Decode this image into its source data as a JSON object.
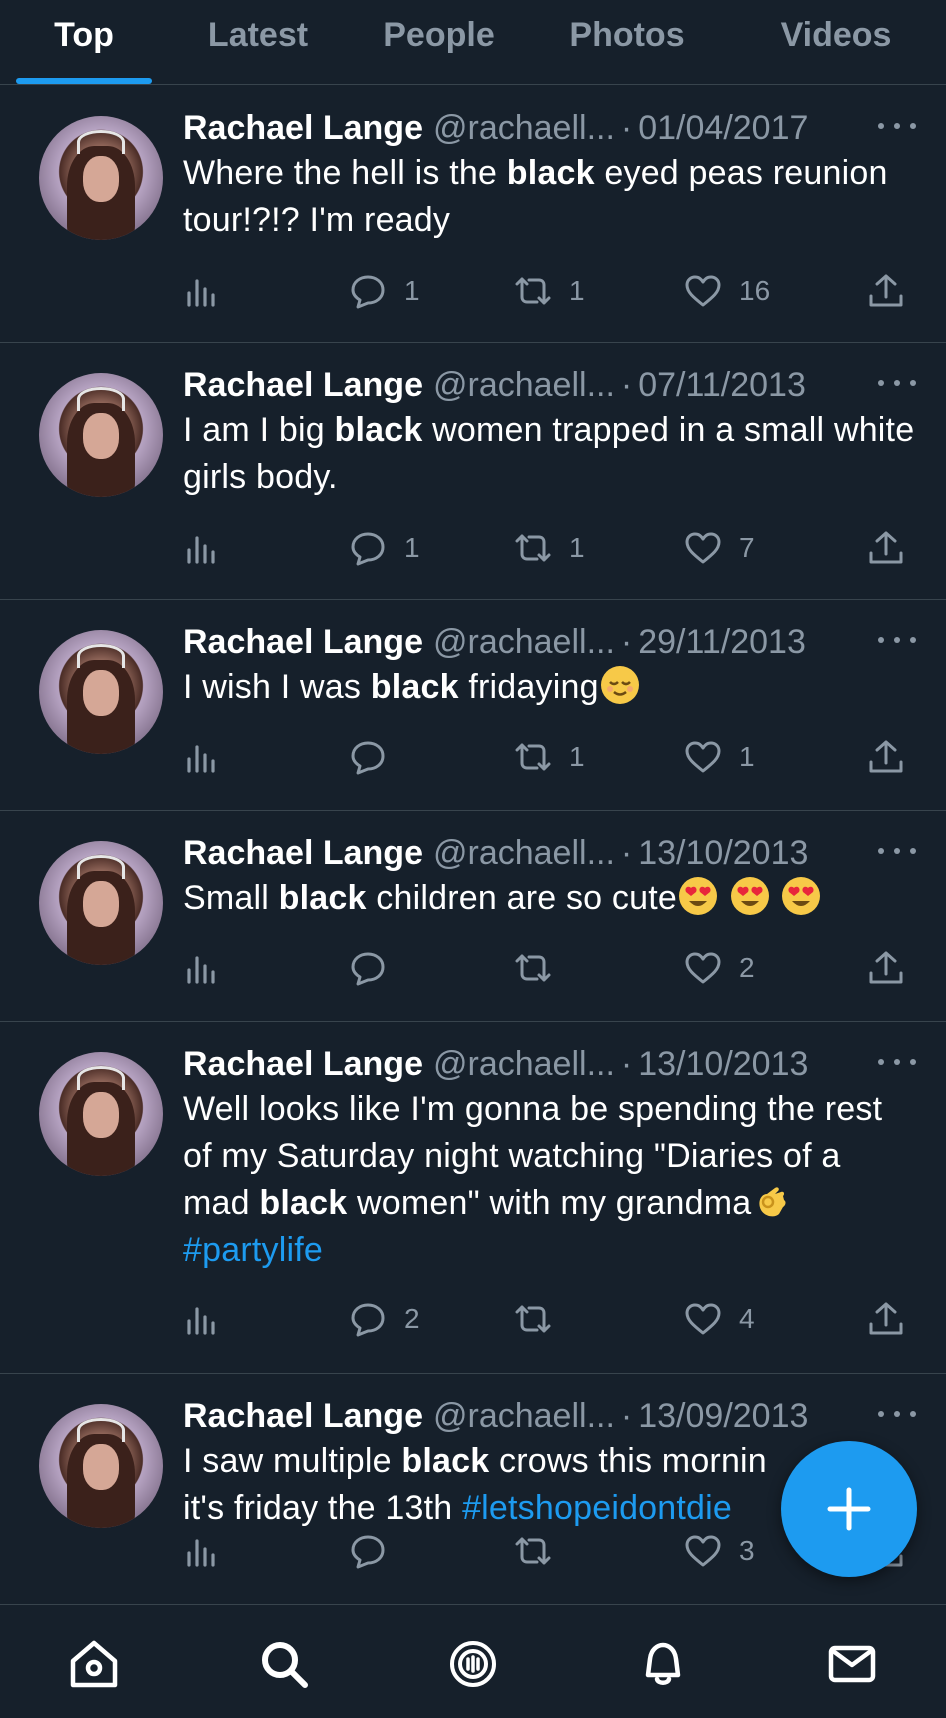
{
  "tabs": [
    {
      "label": "Top",
      "active": true
    },
    {
      "label": "Latest",
      "active": false
    },
    {
      "label": "People",
      "active": false
    },
    {
      "label": "Photos",
      "active": false
    },
    {
      "label": "Videos",
      "active": false
    }
  ],
  "tweets": [
    {
      "name": "Rachael Lange",
      "handle": "@rachaell...",
      "date": "01/04/2017",
      "text_parts": [
        "Where the hell is the ",
        "black",
        " eyed peas reunion tour!?!? I'm ready"
      ],
      "replies": "1",
      "retweets": "1",
      "likes": "16"
    },
    {
      "name": "Rachael Lange",
      "handle": "@rachaell...",
      "date": "07/11/2013",
      "text_parts": [
        "I am I big ",
        "black",
        " women trapped in a small white girls body."
      ],
      "replies": "1",
      "retweets": "1",
      "likes": "7"
    },
    {
      "name": "Rachael Lange",
      "handle": "@rachaell...",
      "date": "29/11/2013",
      "text_parts": [
        "I wish I was ",
        "black",
        " fridaying"
      ],
      "emoji": [
        "relieved-face-emoji"
      ],
      "replies": "",
      "retweets": "1",
      "likes": "1"
    },
    {
      "name": "Rachael Lange",
      "handle": "@rachaell...",
      "date": "13/10/2013",
      "text_parts": [
        "Small ",
        "black",
        " children are so cute"
      ],
      "emoji": [
        "heart-eyes-emoji",
        "heart-eyes-emoji",
        "heart-eyes-emoji"
      ],
      "replies": "",
      "retweets": "",
      "likes": "2"
    },
    {
      "name": "Rachael Lange",
      "handle": "@rachaell...",
      "date": "13/10/2013",
      "text_parts": [
        "Well looks like I'm gonna be spending the rest of my Saturday night watching \"Diaries of a mad ",
        "black",
        " women\" with my grandma"
      ],
      "emoji": [
        "ok-hand-emoji"
      ],
      "hashtag": "#partylife",
      "replies": "2",
      "retweets": "",
      "likes": "4"
    },
    {
      "name": "Rachael Lange",
      "handle": "@rachaell...",
      "date": "13/09/2013",
      "text_parts": [
        "I saw multiple ",
        "black",
        " crows this mornin"
      ],
      "line2": "it's friday the 13th ",
      "hashtag": "#letshopeidontdie",
      "replies": "",
      "retweets": "",
      "likes": "3"
    }
  ],
  "colors": {
    "background": "#16202b",
    "accent": "#1d9bf0",
    "muted": "#8b98a5",
    "divider": "#38444d"
  },
  "icons": {
    "fab": "plus-icon",
    "nav": [
      "home-icon",
      "search-icon",
      "spaces-icon",
      "notifications-bell-icon",
      "messages-envelope-icon"
    ]
  }
}
